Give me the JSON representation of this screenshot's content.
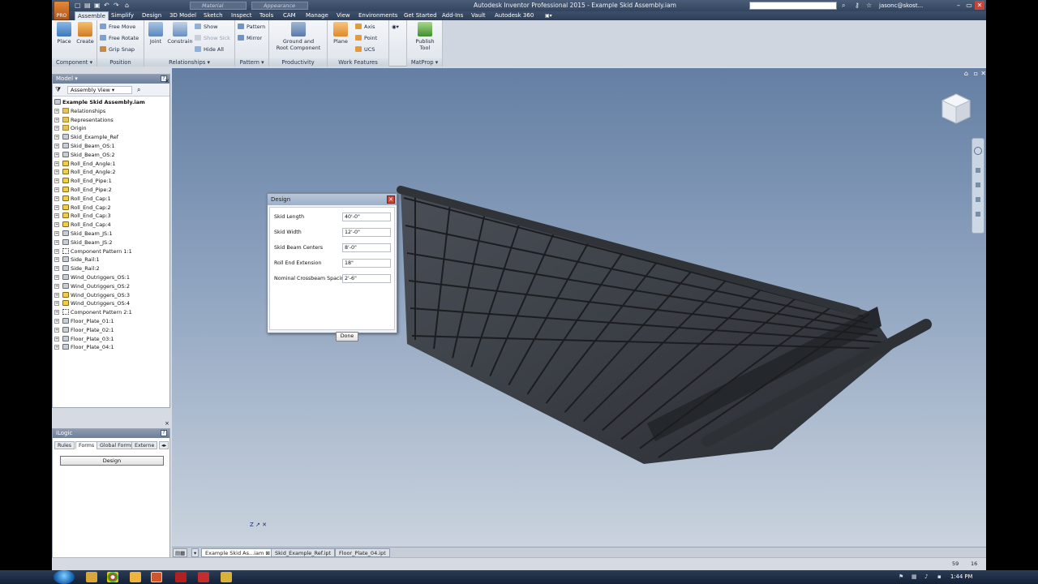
{
  "titlebar": {
    "app_title": "Autodesk Inventor Professional 2015 - Example Skid Assembly.iam",
    "material_placeholder": "Material",
    "appearance_placeholder": "Appearance",
    "user": "jasonc@skost..."
  },
  "app_button": {
    "label": "PRO"
  },
  "ribbon_tabs": [
    "Assemble",
    "Simplify",
    "Design",
    "3D Model",
    "Sketch",
    "Inspect",
    "Tools",
    "CAM",
    "Manage",
    "View",
    "Environments",
    "Get Started",
    "Add-Ins",
    "Vault",
    "Autodesk 360"
  ],
  "ribbon": {
    "component": {
      "label": "Component ▾",
      "place": "Place",
      "create": "Create"
    },
    "position": {
      "label": "Position",
      "free_move": "Free Move",
      "free_rotate": "Free Rotate",
      "grip_snap": "Grip Snap"
    },
    "relationships": {
      "label": "Relationships ▾",
      "joint": "Joint",
      "constrain": "Constrain",
      "show": "Show",
      "show_sick": "Show Sick",
      "hide_all": "Hide All"
    },
    "pattern": {
      "label": "Pattern ▾",
      "pattern": "Pattern",
      "mirror": "Mirror"
    },
    "productivity": {
      "label": "Productivity",
      "ground": "Ground and",
      "root": "Root Component"
    },
    "work_features": {
      "label": "Work Features",
      "plane": "Plane",
      "axis": "Axis",
      "point": "Point",
      "ucs": "UCS"
    },
    "matprop": {
      "label": "MatProp ▾",
      "publish": "Publish",
      "tool": "Tool"
    }
  },
  "model_panel": {
    "header": "Model ▾",
    "view": "Assembly View",
    "root": "Example Skid Assembly.iam",
    "items": [
      {
        "label": "Relationships",
        "icon": "folder"
      },
      {
        "label": "Representations",
        "icon": "folder"
      },
      {
        "label": "Origin",
        "icon": "folder"
      },
      {
        "label": "Skid_Example_Ref",
        "icon": "part"
      },
      {
        "label": "Skid_Beam_OS:1",
        "icon": "part"
      },
      {
        "label": "Skid_Beam_OS:2",
        "icon": "part"
      },
      {
        "label": "Roll_End_Angle:1",
        "icon": "part-yellow"
      },
      {
        "label": "Roll_End_Angle:2",
        "icon": "part-yellow"
      },
      {
        "label": "Roll_End_Pipe:1",
        "icon": "part-yellow"
      },
      {
        "label": "Roll_End_Pipe:2",
        "icon": "part-yellow"
      },
      {
        "label": "Roll_End_Cap:1",
        "icon": "part-yellow"
      },
      {
        "label": "Roll_End_Cap:2",
        "icon": "part-yellow"
      },
      {
        "label": "Roll_End_Cap:3",
        "icon": "part-yellow"
      },
      {
        "label": "Roll_End_Cap:4",
        "icon": "part-yellow"
      },
      {
        "label": "Skid_Beam_JS:1",
        "icon": "part"
      },
      {
        "label": "Skid_Beam_JS:2",
        "icon": "part"
      },
      {
        "label": "Component Pattern 1:1",
        "icon": "pattern"
      },
      {
        "label": "Side_Rail:1",
        "icon": "part"
      },
      {
        "label": "Side_Rail:2",
        "icon": "part"
      },
      {
        "label": "Wind_Outriggers_OS:1",
        "icon": "part"
      },
      {
        "label": "Wind_Outriggers_OS:2",
        "icon": "part"
      },
      {
        "label": "Wind_Outriggers_OS:3",
        "icon": "part-yellow"
      },
      {
        "label": "Wind_Outriggers_OS:4",
        "icon": "part-yellow"
      },
      {
        "label": "Component Pattern 2:1",
        "icon": "pattern"
      },
      {
        "label": "Floor_Plate_01:1",
        "icon": "part"
      },
      {
        "label": "Floor_Plate_02:1",
        "icon": "part"
      },
      {
        "label": "Floor_Plate_03:1",
        "icon": "part"
      },
      {
        "label": "Floor_Plate_04:1",
        "icon": "part"
      }
    ]
  },
  "ilogic_panel": {
    "header": "iLogic",
    "tabs": [
      "Rules",
      "Forms",
      "Global Forms",
      "Externe"
    ],
    "active_tab": "Forms",
    "form_button": "Design"
  },
  "dialog": {
    "title": "Design",
    "params": [
      {
        "label": "Skid Length",
        "value": "40'-0\""
      },
      {
        "label": "Skid Width",
        "value": "12'-0\""
      },
      {
        "label": "Skid Beam Centers",
        "value": "8'-0\""
      },
      {
        "label": "Roll End Extension",
        "value": "18\""
      },
      {
        "label": "Nominal Crossbeam Spacing",
        "value": "2'-6\""
      }
    ],
    "done": "Done"
  },
  "doc_tabs": [
    "Example Skid As...iam",
    "Skid_Example_Ref.ipt",
    "Floor_Plate_04.ipt"
  ],
  "status": {
    "n1": "59",
    "n2": "16"
  },
  "taskbar": {
    "time": "1:44 PM"
  },
  "colors": {
    "ribbon_active_tab": "#e6ebf2",
    "viewport_top": "#647fa3",
    "viewport_bottom": "#cad3de",
    "skid": "#3b3f45"
  }
}
